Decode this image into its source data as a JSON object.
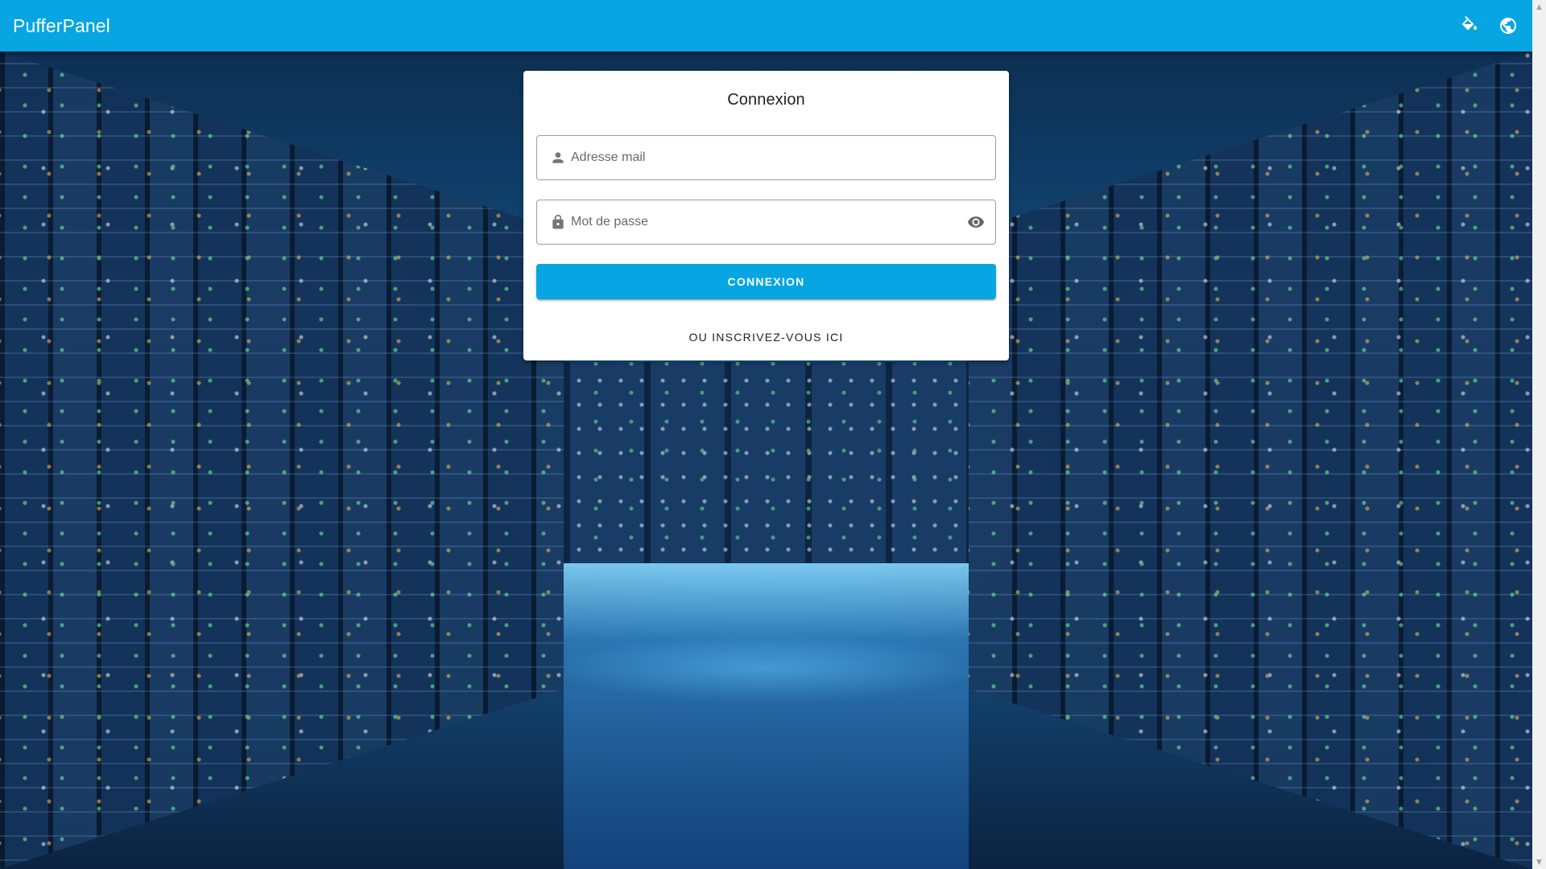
{
  "app": {
    "title": "PufferPanel",
    "accent_color": "#07a5e2"
  },
  "toolbar": {
    "theme_button_icon": "format-color-fill-icon",
    "language_button_icon": "earth-icon"
  },
  "login": {
    "title": "Connexion",
    "email": {
      "placeholder": "Adresse mail",
      "value": "",
      "icon": "account-icon"
    },
    "password": {
      "placeholder": "Mot de passe",
      "value": "",
      "icon": "lock-icon",
      "toggle_icon": "eye-icon"
    },
    "submit_label": "CONNEXION",
    "register_label": "OU INSCRIVEZ-VOUS ICI"
  },
  "scrollbar": {
    "up_arrow": "▲",
    "down_arrow": "▼"
  }
}
